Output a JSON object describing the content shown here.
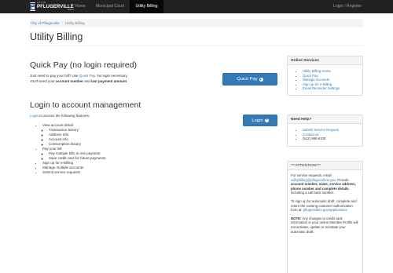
{
  "nav": {
    "logo_small": "CITY OF",
    "logo_big": "PFLUGERVILLE",
    "logo_texas": "TEXAS",
    "home": "Home",
    "court": "Municipal Court",
    "billing": "Utility Billing",
    "login_register": "Login / Register"
  },
  "breadcrumb": {
    "home": "City of Pflugerville",
    "current": "Utility Billing"
  },
  "page_title": "Utility Billing",
  "quick_pay": {
    "heading": "Quick Pay (no login required)",
    "text1": "Just need to pay your bill? Use ",
    "link": "Quick Pay",
    "text2": ". No login necessary.",
    "text3": "You'll need your ",
    "bold1": "account number",
    "text4": " and ",
    "bold2": "last payment amount",
    "text5": ".",
    "button": "Quick Pay"
  },
  "login_section": {
    "heading": "Login to account management",
    "link": "Login",
    "text": " to access the following features:",
    "button": "Login",
    "features": [
      {
        "label": "View account detail",
        "sub": [
          "Transaction history",
          "Address Info",
          "Account info",
          "Consumption history"
        ]
      },
      {
        "label": "Pay your bill",
        "sub": [
          "Pay multiple bills in one payment",
          "Save credit card for future payments"
        ]
      },
      {
        "label": "Sign up for e-Billing",
        "sub": []
      },
      {
        "label": "Manage multiple accounts",
        "sub": []
      },
      {
        "label": "Submit service requests",
        "sub": []
      }
    ]
  },
  "online_services": {
    "heading": "Online Services",
    "items": [
      "Utility Billing Home",
      "Quick Pay",
      "Manage Accounts",
      "Sign up for e-Billing",
      "Email Reminder Settings"
    ]
  },
  "need_help": {
    "heading": "Need Help?",
    "items": [
      "Submit Service Request",
      "Contact us",
      "(512) 990-6100"
    ]
  },
  "attention": {
    "heading": "***ATTENTION***",
    "p1_text": "For service requests, email ",
    "p1_email": "utilitybilling@pflugervilletx.gov",
    "p1_text2": ". Provide ",
    "p1_bold": "account number, name, service address, phone number and complete details",
    "p1_text3": ", including a call back number.",
    "p2_text": "To sign up for automatic draft, complete and return the existing customer authorization form at: ",
    "p2_link": "pflugervilletx.gov/applications",
    "p3_bold": "NOTE:",
    "p3_text": " Any changes to credit card information in your online Member Profile will not activate, update or reinstate your automatic draft."
  }
}
